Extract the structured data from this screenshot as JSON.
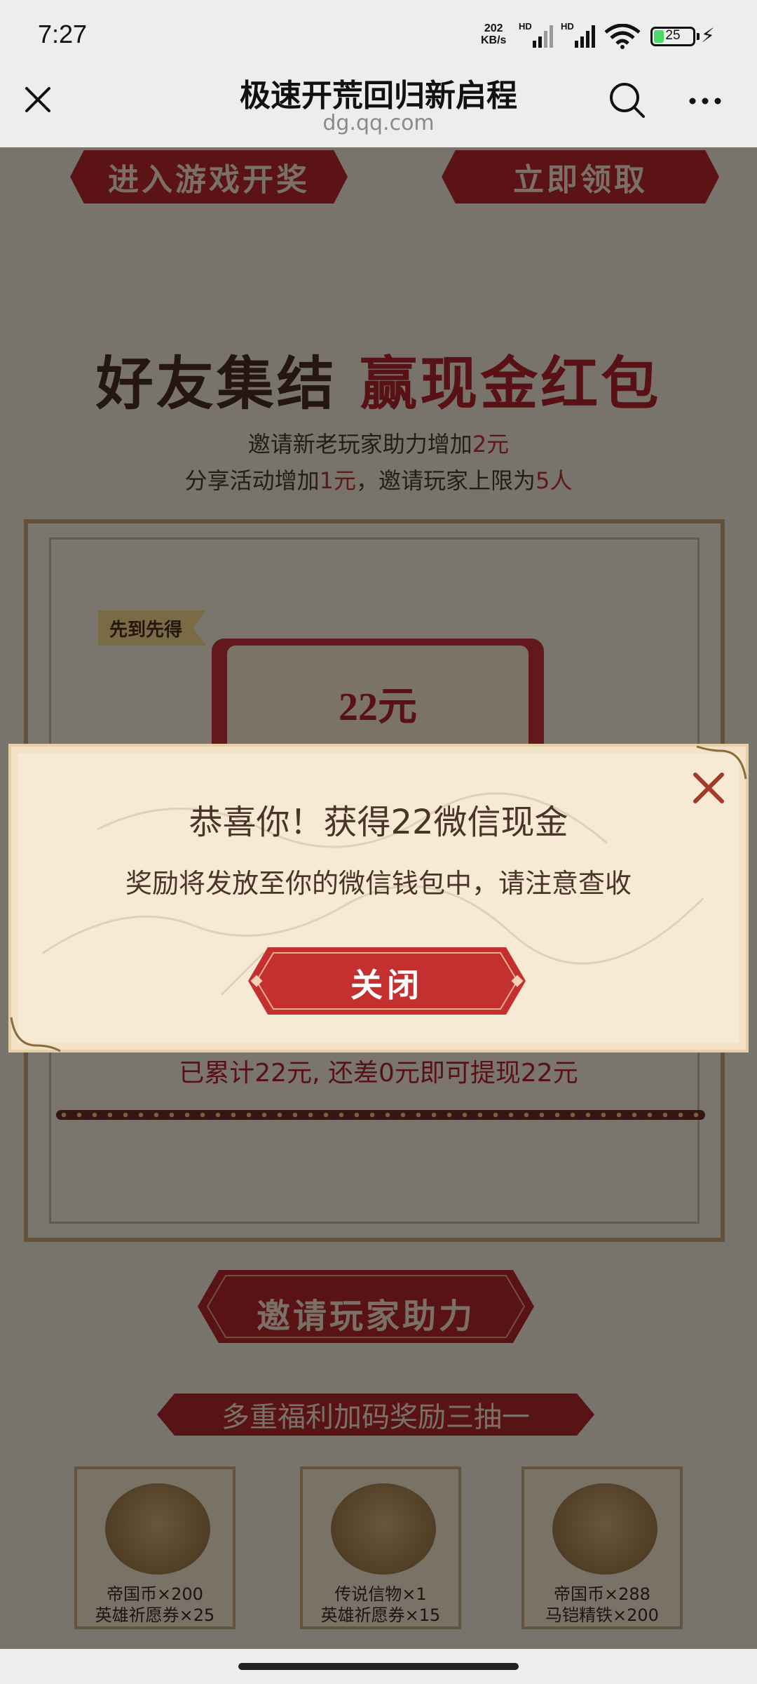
{
  "status_bar": {
    "time": "7:27",
    "net_speed": "202",
    "net_unit": "KB/s",
    "hd1": "HD",
    "hd2": "HD",
    "battery": "25"
  },
  "title_bar": {
    "title": "极速开荒回归新启程",
    "url": "dg.qq.com"
  },
  "page": {
    "top_buttons": [
      "进入游戏开奖",
      "立即领取"
    ],
    "heading_dark": "好友集结",
    "heading_red": "赢现金红包",
    "desc_line1_a": "邀请新老玩家助力增加",
    "desc_line1_b": "2元",
    "desc_line2_a": "分享活动增加",
    "desc_line2_b": "1元",
    "desc_line2_c": "，邀请玩家上限为",
    "desc_line2_d": "5人",
    "tag": "先到先得",
    "envelope_amount": "22元",
    "progress_text": "已累计22元, 还差0元即可提现22元",
    "invite_button": "邀请玩家助力",
    "bonus_banner": "多重福利加码奖励三抽一",
    "rewards": [
      {
        "line1": "帝国币×200",
        "line2": "英雄祈愿券×25"
      },
      {
        "line1": "传说信物×1",
        "line2": "英雄祈愿券×15"
      },
      {
        "line1": "帝国币×288",
        "line2": "马铠精铁×200"
      }
    ]
  },
  "modal": {
    "headline": "恭喜你！获得22微信现金",
    "message": "奖励将发放至你的微信钱包中，请注意查收",
    "close_button": "关闭"
  },
  "colors": {
    "accent_red": "#b0232a",
    "modal_bg": "#f6ead4"
  }
}
